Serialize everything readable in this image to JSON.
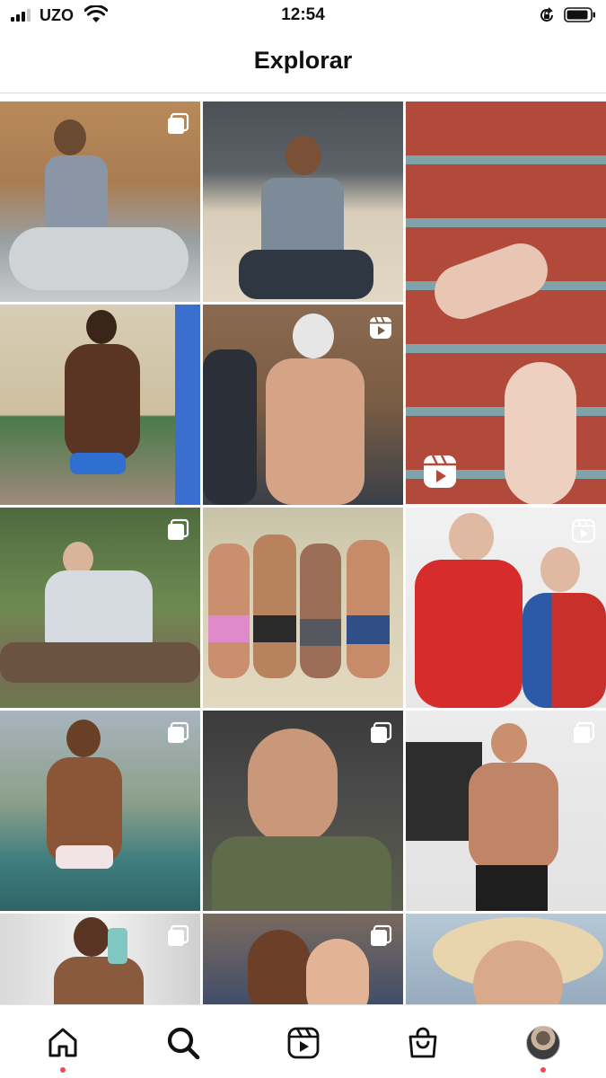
{
  "status_bar": {
    "carrier": "UZO",
    "time": "12:54",
    "icons": [
      "signal-bars-icon",
      "wifi-icon",
      "rotation-lock-icon",
      "battery-icon"
    ]
  },
  "header": {
    "title": "Explorar"
  },
  "grid": {
    "tiles": [
      {
        "name": "post-1",
        "badge": "carousel-icon"
      },
      {
        "name": "post-2",
        "badge": ""
      },
      {
        "name": "post-3",
        "badge": "reels-icon"
      },
      {
        "name": "post-4",
        "badge": ""
      },
      {
        "name": "post-5",
        "badge": "reels-icon"
      },
      {
        "name": "post-6",
        "badge": "carousel-icon"
      },
      {
        "name": "post-7",
        "badge": ""
      },
      {
        "name": "post-8",
        "badge": "reels-icon"
      },
      {
        "name": "post-9",
        "badge": "carousel-icon"
      },
      {
        "name": "post-10",
        "badge": "carousel-icon"
      },
      {
        "name": "post-11",
        "badge": "carousel-icon"
      },
      {
        "name": "post-12",
        "badge": "carousel-icon"
      },
      {
        "name": "post-13",
        "badge": "carousel-icon"
      },
      {
        "name": "post-14",
        "badge": ""
      }
    ]
  },
  "tab_bar": {
    "items": [
      {
        "name": "home",
        "icon": "home-icon",
        "active": false,
        "notification": true
      },
      {
        "name": "search",
        "icon": "search-icon",
        "active": true,
        "notification": false
      },
      {
        "name": "reels",
        "icon": "reels-icon",
        "active": false,
        "notification": false
      },
      {
        "name": "shop",
        "icon": "shopping-bag-icon",
        "active": false,
        "notification": false
      },
      {
        "name": "profile",
        "icon": "profile-avatar",
        "active": false,
        "notification": true
      }
    ]
  },
  "colors": {
    "notification_dot": "#ed4956",
    "divider": "#dbdbdb",
    "text": "#111111"
  }
}
